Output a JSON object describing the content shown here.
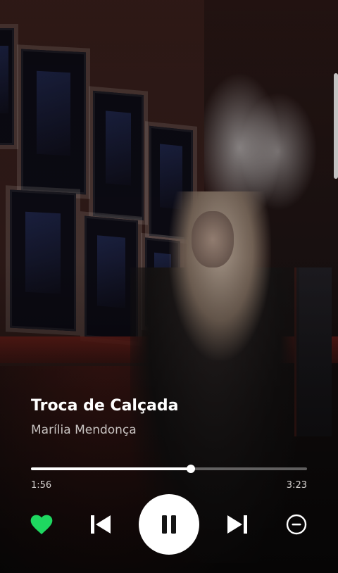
{
  "track": {
    "title": "Troca de Calçada",
    "artist": "Marília Mendonça"
  },
  "playback": {
    "elapsed": "1:56",
    "total": "3:23",
    "progress_fraction": 0.579,
    "state": "playing"
  },
  "controls": {
    "like_icon": "heart-filled-icon",
    "prev_icon": "skip-previous-icon",
    "play_pause_icon": "pause-icon",
    "next_icon": "skip-next-icon",
    "hide_icon": "minus-circle-icon"
  },
  "colors": {
    "accent": "#1ed760",
    "text_primary": "#ffffff",
    "text_secondary": "#c9c4c2"
  }
}
